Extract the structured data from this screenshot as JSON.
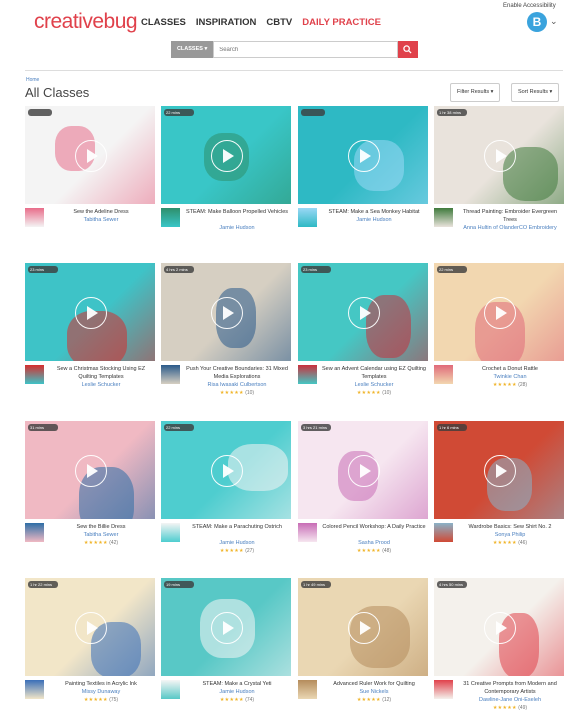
{
  "header": {
    "logo": "creativebug",
    "nav": [
      "CLASSES",
      "INSPIRATION",
      "CBTV",
      "DAILY PRACTICE"
    ],
    "accessibility": "Enable Accessibility",
    "avatar_letter": "B"
  },
  "search": {
    "category": "CLASSES ▾",
    "placeholder": "Search"
  },
  "page": {
    "breadcrumb": "Home",
    "title": "All Classes",
    "filter": "Filter Results ▾",
    "sort": "Sort Results ▾"
  },
  "cards": [
    {
      "title": "Sew the Adeline Dress",
      "instructor": "Tabitha Sewer",
      "duration": "",
      "rating": "",
      "count": "",
      "bg": "#f4f4f4",
      "accent": "#e86d8a"
    },
    {
      "title": "STEAM: Make Balloon Propelled Vehicles",
      "instructor": "Jamie Hudson",
      "duration": "22 mins",
      "rating": "",
      "count": "",
      "bg": "#39c6c7",
      "accent": "#2e8f6b"
    },
    {
      "title": "STEAM: Make a Sea Monkey Habitat",
      "instructor": "Jamie Hudson",
      "duration": "",
      "rating": "",
      "count": "",
      "bg": "#2eb9c4",
      "accent": "#9ad8f5"
    },
    {
      "title": "Thread Painting: Embroider Evergreen Trees",
      "instructor": "Anna Hultin of OlanderCO Embroidery",
      "duration": "1 hr 38 mins",
      "rating": "",
      "count": "",
      "bg": "#e9e3dc",
      "accent": "#3f7a3c"
    },
    {
      "title": "Sew a Christmas Stocking Using EZ Quilting Templates",
      "instructor": "Leslie Schucker",
      "duration": "23 mins",
      "rating": "",
      "count": "",
      "bg": "#3ec3c7",
      "accent": "#d62e2e"
    },
    {
      "title": "Push Your Creative Boundaries: 31 Mixed Media Explorations",
      "instructor": "Risa Iwasaki Culbertson",
      "duration": "4 hrs 2 mins",
      "rating": "★★★★★",
      "count": "(10)",
      "bg": "#d6cfc2",
      "accent": "#2a5a8a"
    },
    {
      "title": "Sew an Advent Calendar using EZ Quilting Templates",
      "instructor": "Leslie Schucker",
      "duration": "23 mins",
      "rating": "★★★★★",
      "count": "(10)",
      "bg": "#45c7c4",
      "accent": "#c9303d"
    },
    {
      "title": "Crochet a Donut Rattle",
      "instructor": "Twinkie Chan",
      "duration": "22 mins",
      "rating": "★★★★★",
      "count": "(28)",
      "bg": "#f2d7b0",
      "accent": "#e06a7a"
    },
    {
      "title": "Sew the Billie Dress",
      "instructor": "Tabitha Sewer",
      "duration": "31 mins",
      "rating": "★★★★★",
      "count": "(42)",
      "bg": "#f0b9c3",
      "accent": "#2e6ea6"
    },
    {
      "title": "STEAM: Make a Parachuting Ostrich",
      "instructor": "Jamie Hudson",
      "duration": "22 mins",
      "rating": "★★★★★",
      "count": "(27)",
      "bg": "#4ecdcf",
      "accent": "#f4f4f4"
    },
    {
      "title": "Colored Pencil Workshop: A Daily Practice",
      "instructor": "Sasha Prood",
      "duration": "3 hrs 21 mins",
      "rating": "★★★★★",
      "count": "(48)",
      "bg": "#f6e6f0",
      "accent": "#c86db6"
    },
    {
      "title": "Wardrobe Basics: Sew Shirt No. 2",
      "instructor": "Sonya Philip",
      "duration": "1 hr 6 mins",
      "rating": "★★★★★",
      "count": "(46)",
      "bg": "#d04a35",
      "accent": "#8ab2c8"
    },
    {
      "title": "Painting Textiles in Acrylic Ink",
      "instructor": "Missy Dunaway",
      "duration": "1 hr 22 mins",
      "rating": "★★★★★",
      "count": "(75)",
      "bg": "#f2e6c8",
      "accent": "#3a6fb8"
    },
    {
      "title": "STEAM: Make a Crystal Yeti",
      "instructor": "Jamie Hudson",
      "duration": "19 mins",
      "rating": "★★★★★",
      "count": "(74)",
      "bg": "#58c8c6",
      "accent": "#f5f5f5"
    },
    {
      "title": "Advanced Ruler Work for Quilting",
      "instructor": "Sue Nickels",
      "duration": "1 hr 49 mins",
      "rating": "★★★★★",
      "count": "(12)",
      "bg": "#ead7b3",
      "accent": "#b58c5c"
    },
    {
      "title": "31 Creative Prompts from Modern and Contemporary Artists",
      "instructor": "Dawline-Jane Oni-Eseleh",
      "duration": "4 hrs 50 mins",
      "rating": "★★★★★",
      "count": "(49)",
      "bg": "#f4f1ec",
      "accent": "#e0414b"
    }
  ]
}
